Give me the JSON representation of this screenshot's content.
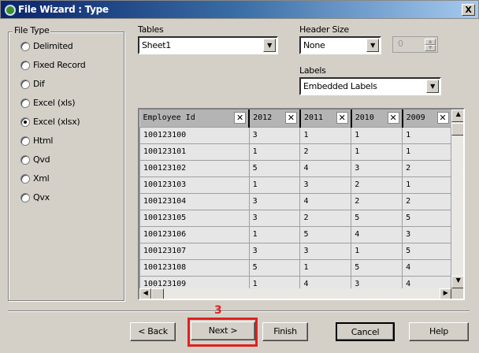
{
  "window": {
    "title": "File Wizard : Type",
    "close": "X"
  },
  "file_type": {
    "label": "File Type",
    "options": [
      "Delimited",
      "Fixed Record",
      "Dif",
      "Excel (xls)",
      "Excel (xlsx)",
      "Html",
      "Qvd",
      "Xml",
      "Qvx"
    ],
    "selected": "Excel (xlsx)"
  },
  "tables": {
    "label": "Tables",
    "value": "Sheet1"
  },
  "header_size": {
    "label": "Header Size",
    "value": "None",
    "spin_value": "0"
  },
  "labels": {
    "label": "Labels",
    "value": "Embedded Labels"
  },
  "grid": {
    "columns": [
      "Employee Id",
      "2012",
      "2011",
      "2010",
      "2009"
    ],
    "rows": [
      [
        "100123100",
        "3",
        "1",
        "1",
        "1"
      ],
      [
        "100123101",
        "1",
        "2",
        "1",
        "1"
      ],
      [
        "100123102",
        "5",
        "4",
        "3",
        "2"
      ],
      [
        "100123103",
        "1",
        "3",
        "2",
        "1"
      ],
      [
        "100123104",
        "3",
        "4",
        "2",
        "2"
      ],
      [
        "100123105",
        "3",
        "2",
        "5",
        "5"
      ],
      [
        "100123106",
        "1",
        "5",
        "4",
        "3"
      ],
      [
        "100123107",
        "3",
        "3",
        "1",
        "5"
      ],
      [
        "100123108",
        "5",
        "1",
        "5",
        "4"
      ],
      [
        "100123109",
        "1",
        "4",
        "3",
        "4"
      ]
    ]
  },
  "buttons": {
    "back": "< Back",
    "next": "Next >",
    "finish": "Finish",
    "cancel": "Cancel",
    "help": "Help"
  },
  "annotation": {
    "step": "3",
    "color": "#e02020"
  }
}
